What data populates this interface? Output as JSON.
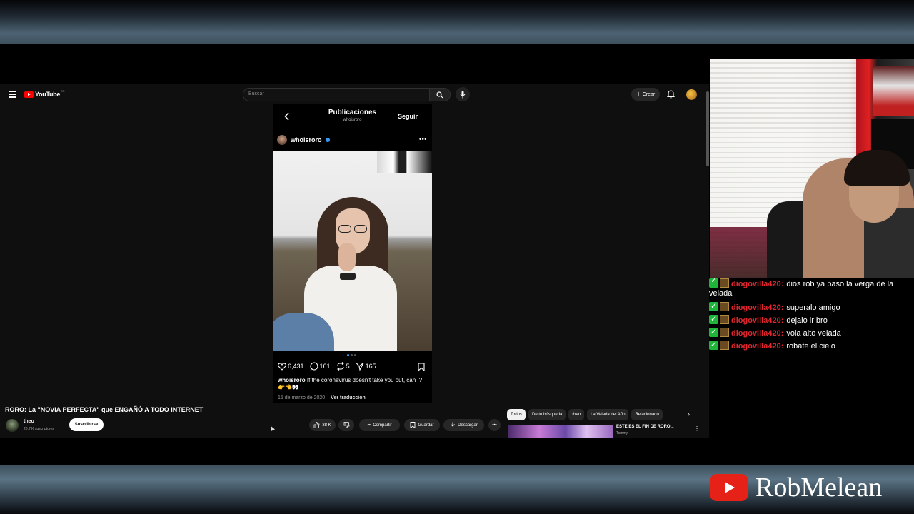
{
  "youtube": {
    "logo_text": "YouTube",
    "logo_country": "ES",
    "search_placeholder": "Buscar",
    "create_label": "Crear",
    "video_title": "RORO: La \"NOVIA PERFECTA\" que ENGAÑÓ A TODO INTERNET",
    "channel_name": "theo",
    "channel_subs": "20,7 K suscriptores",
    "subscribe_label": "Suscribirse",
    "likes": "38 K",
    "share_label": "Compartir",
    "save_label": "Guardar",
    "download_label": "Descargar",
    "chips": [
      "Todos",
      "De tu búsqueda",
      "theo",
      "La Velada del Año",
      "Relacionado"
    ],
    "recommended_title": "ESTE ES EL FIN DE RORO...",
    "recommended_channel": "Tommy"
  },
  "instagram": {
    "header_title": "Publicaciones",
    "header_sub": "whoisroro",
    "follow_label": "Seguir",
    "username": "whoisroro",
    "likes": "6,431",
    "comments": "161",
    "reposts": "5",
    "shares": "165",
    "caption_user": "whoisroro",
    "caption_text": "If the coronavirus doesn't take you out, can I? 👉👈👀",
    "date": "15 de marzo de 2020",
    "translate_label": "Ver traducción"
  },
  "chat": [
    {
      "user": "diogovilla420:",
      "message": "dios rob ya paso la verga de la velada"
    },
    {
      "user": "diogovilla420:",
      "message": "superalo amigo"
    },
    {
      "user": "diogovilla420:",
      "message": "dejalo ir bro"
    },
    {
      "user": "diogovilla420:",
      "message": "vola alto velada"
    },
    {
      "user": "diogovilla420:",
      "message": "robate el cielo"
    }
  ],
  "brand": {
    "name": "RobMelean"
  }
}
